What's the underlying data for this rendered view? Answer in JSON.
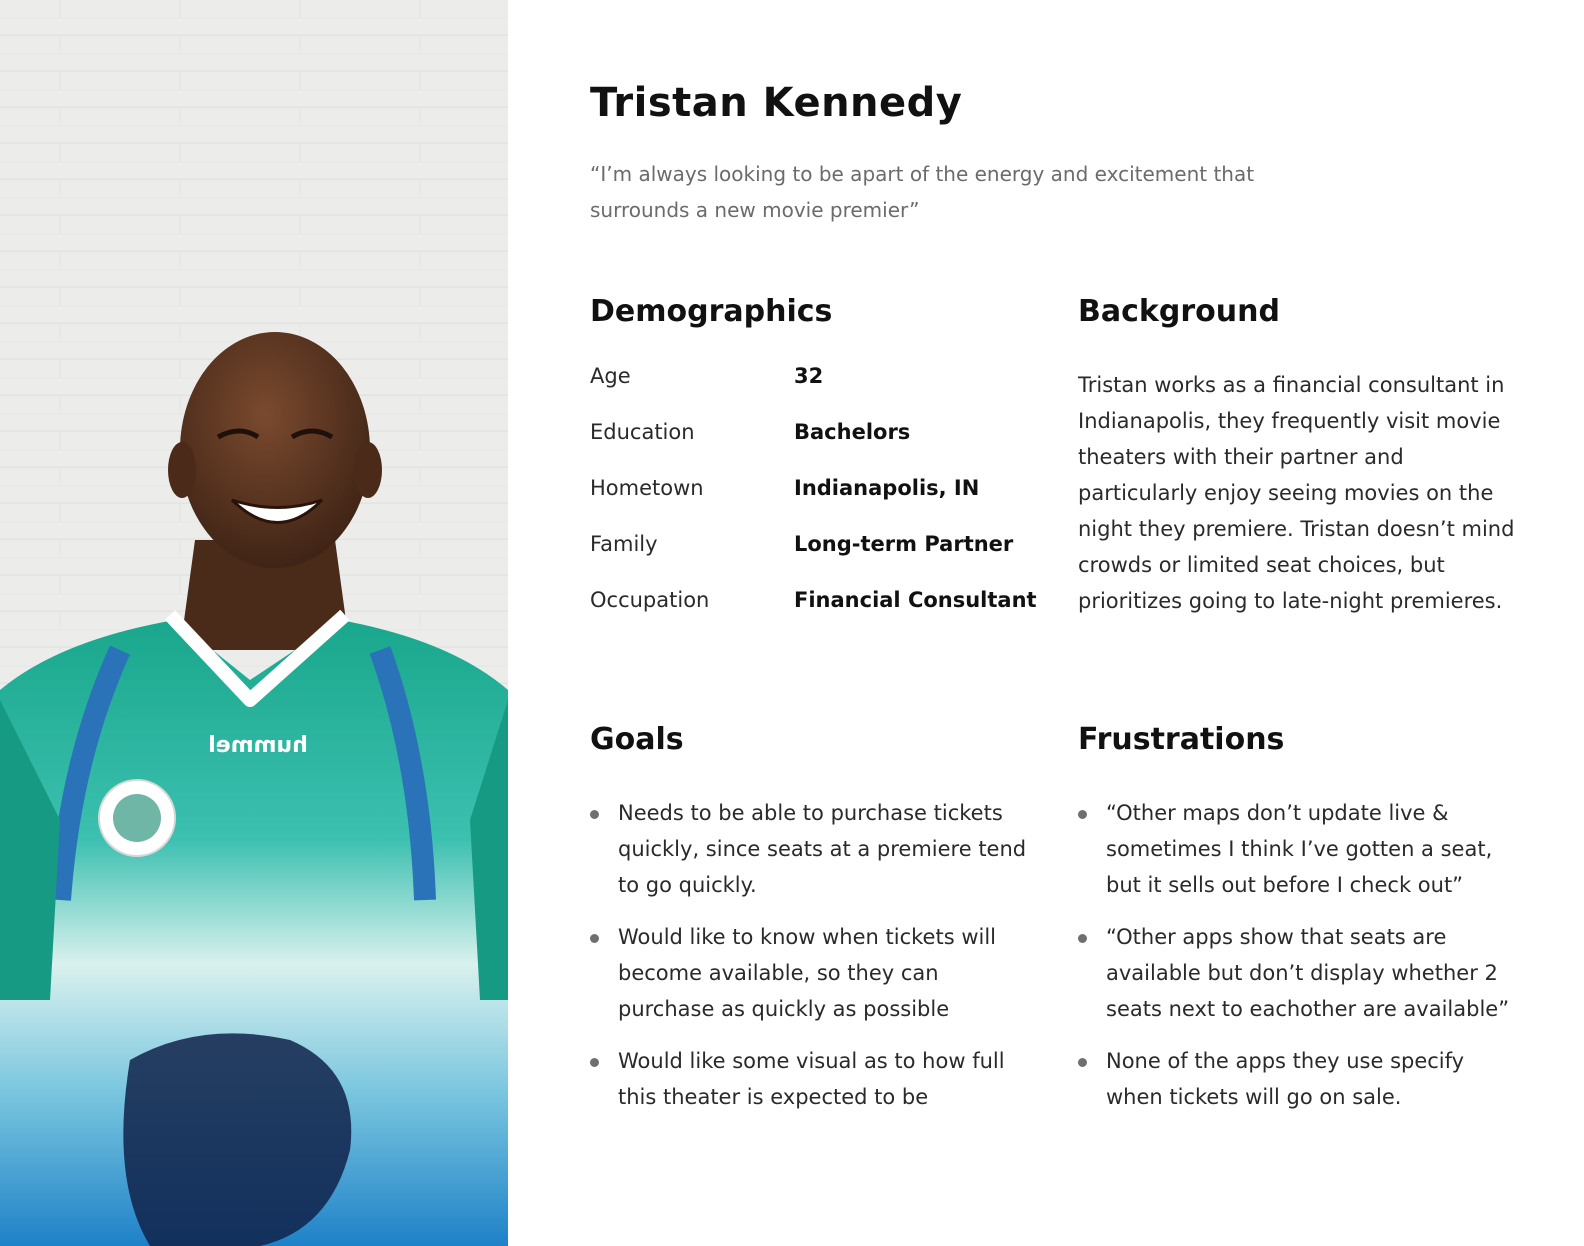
{
  "persona": {
    "name": "Tristan Kennedy",
    "quote": "“I’m always looking to be apart of the energy and excitement that surrounds a new movie premier”",
    "photo_alt": "Portrait photo"
  },
  "demographics": {
    "title": "Demographics",
    "rows": [
      {
        "label": "Age",
        "value": "32"
      },
      {
        "label": "Education",
        "value": "Bachelors"
      },
      {
        "label": "Hometown",
        "value": "Indianapolis, IN"
      },
      {
        "label": "Family",
        "value": "Long-term Partner"
      },
      {
        "label": "Occupation",
        "value": "Financial Consultant"
      }
    ]
  },
  "background": {
    "title": "Background",
    "text": "Tristan works as a financial consultant in Indianapolis, they frequently visit movie theaters with their partner and particularly enjoy seeing movies on the night they premiere. Tristan doesn’t mind crowds or limited seat choices, but prioritizes going to late-night premieres."
  },
  "goals": {
    "title": "Goals",
    "items": [
      "Needs to be able to purchase tickets quickly, since seats at a premiere tend to go quickly.",
      "Would like to know when tickets will become available, so they can purchase as quickly as possible",
      "Would like some visual as to how full this theater is expected to be"
    ]
  },
  "frustrations": {
    "title": "Frustrations",
    "items": [
      "“Other maps don’t update live & sometimes I think I’ve gotten a seat, but it sells out before I check out”",
      "“Other apps show that seats are available but don’t display whether 2 seats next to eachother are available”",
      "None of the apps they use specify when tickets will go on sale."
    ]
  },
  "colors": {
    "text_primary": "#111111",
    "text_secondary": "#6b6b6b",
    "bullet": "#6f6f6f",
    "jersey_green": "#1aa68f",
    "jersey_blue": "#2a73b8",
    "skin": "#5a3420",
    "wall": "#ecedec"
  },
  "jersey": {
    "brand": "hummel"
  }
}
